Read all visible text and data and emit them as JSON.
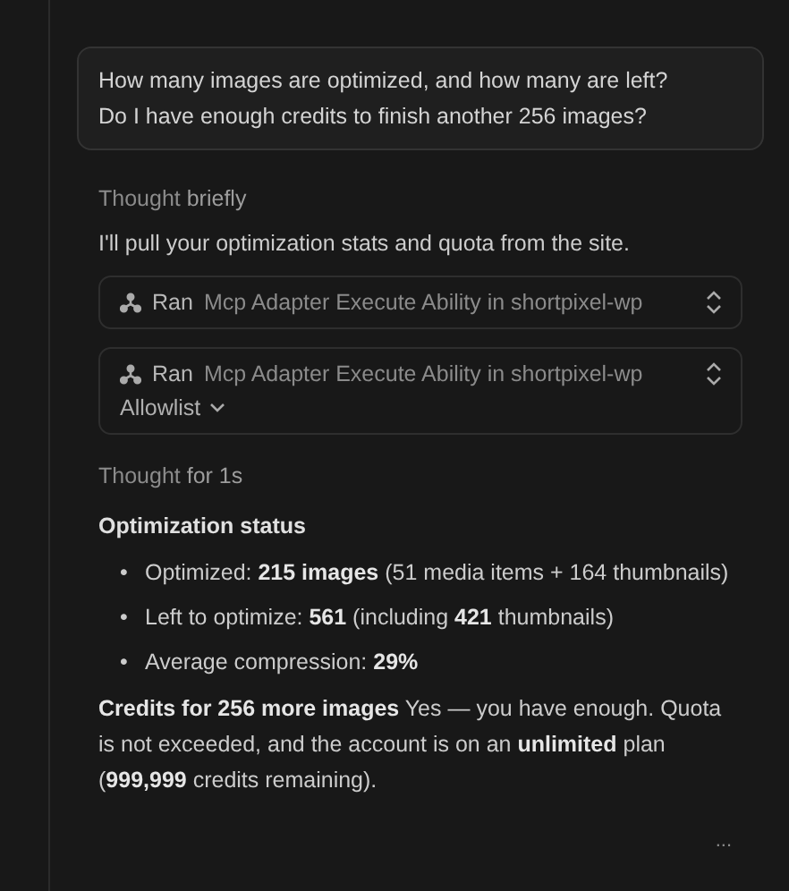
{
  "user_message": "How many images are optimized, and how many are left?\nDo I have enough credits to finish another 256 images?",
  "blocks": [
    {
      "kind": "thought",
      "label": "Thought",
      "detail": "briefly"
    },
    {
      "kind": "text",
      "text": "I'll pull your optimization stats and quota from the site."
    },
    {
      "kind": "tool",
      "verb": "Ran",
      "title": "Mcp Adapter Execute Ability in shortpixel-wp"
    },
    {
      "kind": "tool",
      "verb": "Ran",
      "title": "Mcp Adapter Execute Ability in shortpixel-wp",
      "dropdown": "Allowlist"
    },
    {
      "kind": "thought",
      "label": "Thought",
      "detail": "for 1s"
    },
    {
      "kind": "heading",
      "text": "Optimization status"
    },
    {
      "kind": "bullets",
      "items": [
        {
          "marker": "•",
          "text": "Optimized: **215 images** (51 media items + 164 thumbnails)"
        },
        {
          "marker": "•",
          "text": "Left to optimize: **561** (including **421** thumbnails)"
        },
        {
          "marker": "•",
          "text": "Average compression: **29%**"
        }
      ]
    },
    {
      "kind": "text",
      "text": "**Credits for 256 more images** Yes — you have enough. Quota is not exceeded, and the account is on an **unlimited** plan (**999,999** credits remaining)."
    },
    {
      "kind": "more",
      "text": "..."
    }
  ]
}
